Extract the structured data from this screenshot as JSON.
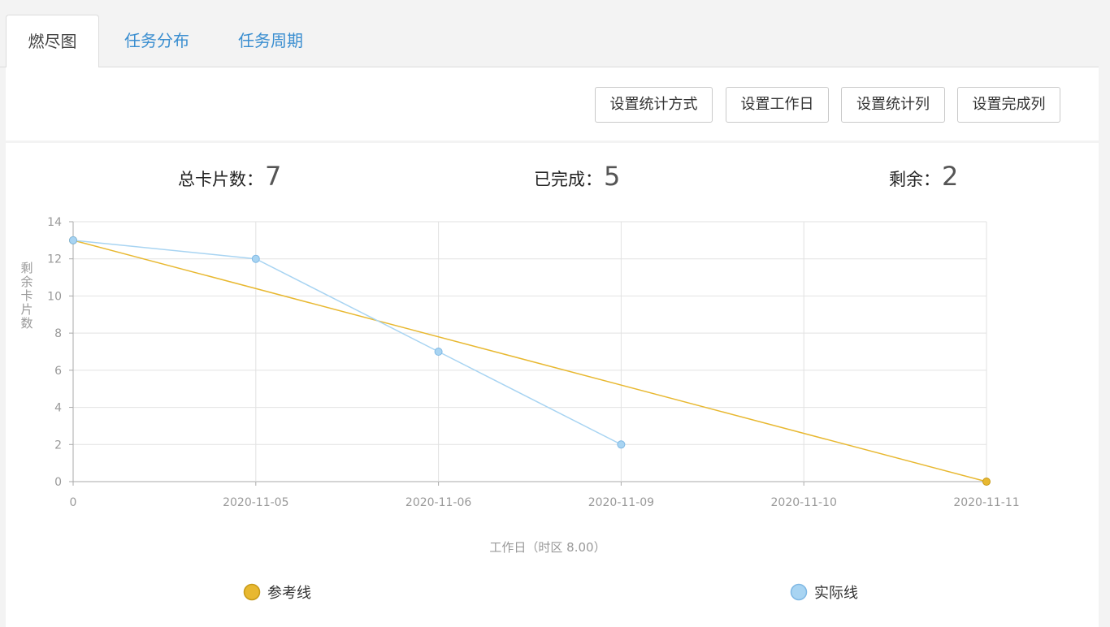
{
  "tabs": [
    {
      "label": "燃尽图",
      "active": true
    },
    {
      "label": "任务分布",
      "active": false
    },
    {
      "label": "任务周期",
      "active": false
    }
  ],
  "toolbar": {
    "stat_method": "设置统计方式",
    "workday": "设置工作日",
    "stat_column": "设置统计列",
    "done_column": "设置完成列"
  },
  "stats": {
    "total_label": "总卡片数：",
    "total": "7",
    "done_label": "已完成：",
    "done": "5",
    "remaining_label": "剩余：",
    "remaining": "2"
  },
  "chart_data": {
    "type": "line",
    "categories": [
      "0",
      "2020-11-05",
      "2020-11-06",
      "2020-11-09",
      "2020-11-10",
      "2020-11-11"
    ],
    "xlabel": "工作日（时区 8.00）",
    "ylabel": "剩余卡片数",
    "ylim": [
      0,
      14
    ],
    "yticks": [
      0,
      2,
      4,
      6,
      8,
      10,
      12,
      14
    ],
    "grid": true,
    "legend_position": "bottom",
    "series": [
      {
        "name": "参考线",
        "color": "#e8b830",
        "values": [
          13,
          null,
          null,
          null,
          null,
          0
        ]
      },
      {
        "name": "实际线",
        "color": "#a8d4f2",
        "values": [
          13,
          12,
          7,
          2,
          null,
          null
        ]
      }
    ]
  }
}
